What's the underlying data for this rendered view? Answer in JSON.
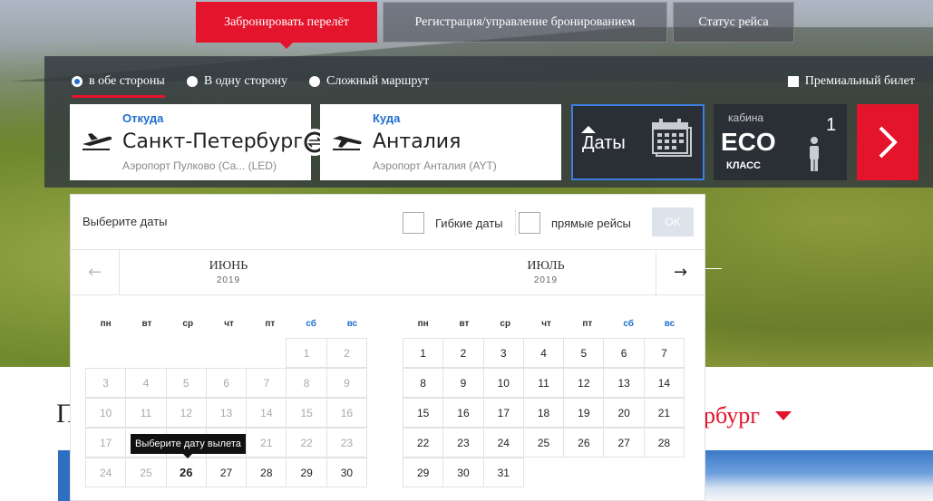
{
  "nav": {
    "tabs": [
      {
        "label": "Забронировать перелёт",
        "active": true
      },
      {
        "label": "Регистрация/управление бронированием",
        "active": false
      },
      {
        "label": "Статус рейса",
        "active": false
      }
    ]
  },
  "search": {
    "trip_types": [
      {
        "label": "в обе стороны",
        "selected": true
      },
      {
        "label": "В одну сторону",
        "selected": false
      },
      {
        "label": "Сложный маршрут",
        "selected": false
      }
    ],
    "premium_label": "Премиальный билет",
    "from": {
      "label": "Откуда",
      "city": "Санкт-Петербург",
      "airport": "Аэропорт Пулково (Са...   (LED)"
    },
    "to": {
      "label": "Куда",
      "city": "Анталия",
      "airport": "Аэропорт Анталия (AYT)"
    },
    "dates_label": "Даты",
    "cabin": {
      "label": "кабина",
      "class_code": "ECO",
      "class_label": "КЛАСС",
      "passengers": "1"
    }
  },
  "calendar": {
    "title": "Выберите даты",
    "flexible_label": "Гибкие даты",
    "direct_label": "прямые рейсы",
    "ok_label": "OK",
    "prev_arrow": "←",
    "next_arrow": "→",
    "weekdays": [
      "пн",
      "вт",
      "ср",
      "чт",
      "пт",
      "сб",
      "вс"
    ],
    "tooltip": "Выберите дату вылета",
    "months": [
      {
        "name": "ИЮНЬ",
        "year": "2019",
        "weeks": [
          [
            "",
            "",
            "",
            "",
            "",
            "1",
            "2"
          ],
          [
            "3",
            "4",
            "5",
            "6",
            "7",
            "8",
            "9"
          ],
          [
            "10",
            "11",
            "12",
            "13",
            "14",
            "15",
            "16"
          ],
          [
            "17",
            "18",
            "19",
            "20",
            "21",
            "22",
            "23"
          ],
          [
            "24",
            "25",
            "26",
            "27",
            "28",
            "29",
            "30"
          ]
        ],
        "past_until": 25,
        "today": "26"
      },
      {
        "name": "ИЮЛЬ",
        "year": "2019",
        "weeks": [
          [
            "1",
            "2",
            "3",
            "4",
            "5",
            "6",
            "7"
          ],
          [
            "8",
            "9",
            "10",
            "11",
            "12",
            "13",
            "14"
          ],
          [
            "15",
            "16",
            "17",
            "18",
            "19",
            "20",
            "21"
          ],
          [
            "22",
            "23",
            "24",
            "25",
            "26",
            "27",
            "28"
          ],
          [
            "29",
            "30",
            "31",
            "",
            "",
            "",
            ""
          ]
        ],
        "past_until": 0,
        "today": ""
      }
    ]
  },
  "below": {
    "title": "П",
    "city": "рбург"
  },
  "colors": {
    "accent": "#e4142c",
    "link": "#1f6fd0",
    "panel": "#2a2f36"
  }
}
